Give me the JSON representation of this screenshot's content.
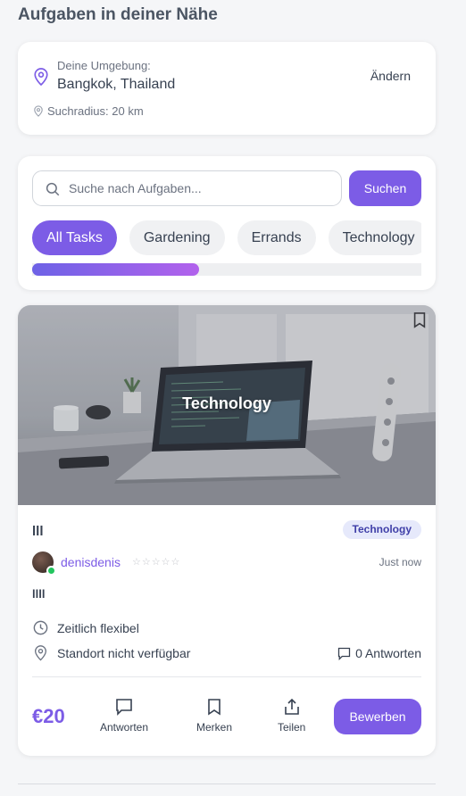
{
  "page": {
    "title": "Aufgaben in deiner Nähe"
  },
  "location": {
    "label": "Deine Umgebung:",
    "value": "Bangkok, Thailand",
    "change_label": "Ändern",
    "radius_label": "Suchradius: 20 km"
  },
  "search": {
    "placeholder": "Suche nach Aufgaben...",
    "button_label": "Suchen"
  },
  "categories": {
    "items": [
      "All Tasks",
      "Gardening",
      "Errands",
      "Technology"
    ],
    "active": "All Tasks",
    "scroll_fraction": 0.43
  },
  "task": {
    "image_label": "Technology",
    "title": "lll",
    "badge": "Technology",
    "user": {
      "name": "denisdenis",
      "online": true,
      "stars": "☆☆☆☆☆",
      "rating": 0
    },
    "posted": "Just now",
    "description": "llll",
    "time_text": "Zeitlich flexibel",
    "location_text": "Standort nicht verfügbar",
    "replies_text": "0 Antworten",
    "price": "€20",
    "actions": {
      "reply": "Antworten",
      "save": "Merken",
      "share": "Teilen"
    },
    "apply_label": "Bewerben"
  },
  "colors": {
    "accent": "#7c5ce6",
    "online": "#22c55e",
    "badge_bg": "#e6e9fb"
  }
}
